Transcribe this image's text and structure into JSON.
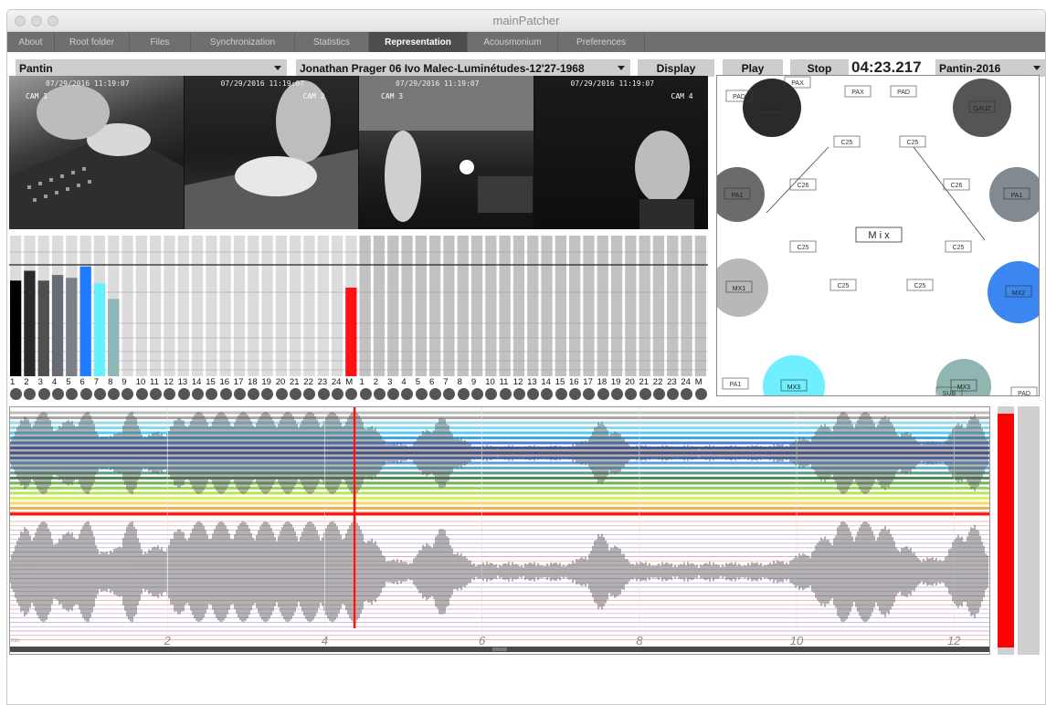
{
  "window": {
    "title": "mainPatcher"
  },
  "tabs": [
    {
      "label": "About",
      "active": false
    },
    {
      "label": "Root folder",
      "active": false
    },
    {
      "label": "Files",
      "active": false
    },
    {
      "label": "Synchronization",
      "active": false
    },
    {
      "label": "Statistics",
      "active": false
    },
    {
      "label": "Representation",
      "active": true
    },
    {
      "label": "Acousmonium",
      "active": false
    },
    {
      "label": "Preferences",
      "active": false
    }
  ],
  "controls": {
    "venue_select": "Pantin",
    "piece_select": "Jonathan Prager 06 Ivo Malec-Luminétudes-12'27-1968",
    "display_label": "Display",
    "play_label": "Play",
    "stop_label": "Stop",
    "time": "04:23.217",
    "config_select": "Pantin-2016"
  },
  "video": {
    "cams": [
      {
        "stamp": "07/29/2016 11:19:07",
        "label": "CAM 1"
      },
      {
        "stamp": "07/29/2016 11:19:07",
        "label": "CAM 2"
      },
      {
        "stamp": "07/29/2016 11:19:07",
        "label": "CAM 3"
      },
      {
        "stamp": "07/29/2016 11:19:07",
        "label": "CAM 4"
      }
    ]
  },
  "meters": {
    "labels_a": [
      "1",
      "2",
      "3",
      "4",
      "5",
      "6",
      "7",
      "8",
      "9",
      "10",
      "11",
      "12",
      "13",
      "14",
      "15",
      "16",
      "17",
      "18",
      "19",
      "20",
      "21",
      "22",
      "23",
      "24",
      "M"
    ],
    "labels_b": [
      "1",
      "2",
      "3",
      "4",
      "5",
      "6",
      "7",
      "8",
      "9",
      "10",
      "11",
      "12",
      "13",
      "14",
      "15",
      "16",
      "17",
      "18",
      "19",
      "20",
      "21",
      "22",
      "23",
      "24",
      "M"
    ],
    "levels_a": [
      0.68,
      0.75,
      0.68,
      0.72,
      0.7,
      0.78,
      0.66,
      0.55,
      0,
      0,
      0,
      0,
      0,
      0,
      0,
      0,
      0,
      0,
      0,
      0,
      0,
      0,
      0,
      0,
      0.63
    ],
    "colors_a": [
      "#000000",
      "#2a2a2a",
      "#505050",
      "#666b75",
      "#7a8088",
      "#1e7bff",
      "#63f0ff",
      "#8fb6b6",
      "#000",
      "#000",
      "#000",
      "#000",
      "#000",
      "#000",
      "#000",
      "#000",
      "#000",
      "#000",
      "#000",
      "#000",
      "#000",
      "#000",
      "#000",
      "#000",
      "#ff1111"
    ]
  },
  "spatial": {
    "mix_label": "M i x",
    "speakers": [
      {
        "label": "GAUZ",
        "color": "#2a2a2a"
      },
      {
        "label": "GAUZ",
        "color": "#555555"
      },
      {
        "label": "PA1",
        "color": "#6b6b6b"
      },
      {
        "label": "PA1",
        "color": "#808a90"
      },
      {
        "label": "MX1",
        "color": "#b8b8b8"
      },
      {
        "label": "MX2",
        "color": "#3b86f0"
      },
      {
        "label": "MX3",
        "color": "#6fefff"
      },
      {
        "label": "MX3",
        "color": "#8fb6b0"
      }
    ],
    "tags": [
      "PAD",
      "PAX",
      "PAX",
      "PAD",
      "C25",
      "C25",
      "C26",
      "C26",
      "C25",
      "C25",
      "C25",
      "C25",
      "PA1",
      "SUB",
      "PAD"
    ]
  },
  "timeline": {
    "ticks": [
      "2",
      "4",
      "6",
      "8",
      "10",
      "12"
    ],
    "unit": "min",
    "playhead_min": 4.38,
    "total_min": 12.45
  },
  "colors": {
    "playhead": "#ff1111",
    "tab_active": "#4d4d4d",
    "tab_bg": "#6f6f6f"
  }
}
